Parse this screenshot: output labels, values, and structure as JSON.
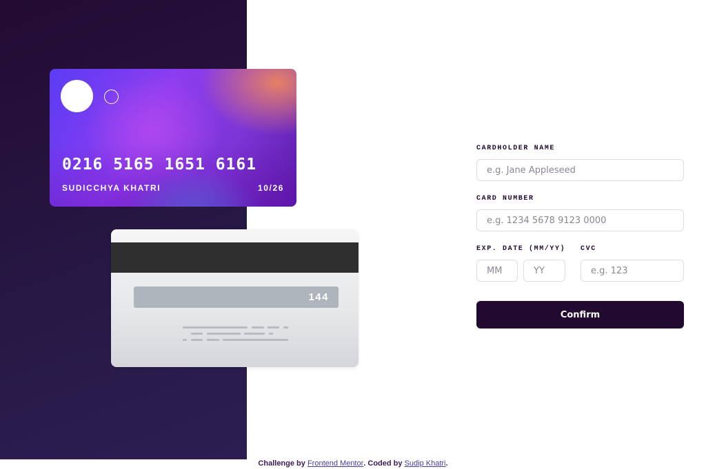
{
  "card_front": {
    "number": "0216 5165 1651 6161",
    "holder": "SUDICCHYA KHATRI",
    "expiry": "10/26"
  },
  "card_back": {
    "cvc": "144"
  },
  "form": {
    "name_label": "CARDHOLDER NAME",
    "name_placeholder": "e.g. Jane Appleseed",
    "number_label": "CARD NUMBER",
    "number_placeholder": "e.g. 1234 5678 9123 0000",
    "exp_label": "EXP. DATE (MM/YY)",
    "mm_placeholder": "MM",
    "yy_placeholder": "YY",
    "cvc_label": "CVC",
    "cvc_placeholder": "e.g. 123",
    "confirm_label": "Confirm"
  },
  "footer": {
    "challenge_prefix": "Challenge by",
    "challenge_link": "Frontend Mentor",
    "coded_prefix": ". Coded by",
    "coded_link": "Sudip Khatri",
    "suffix": "."
  },
  "colors": {
    "dark_violet": "#21092f",
    "border": "#dedddf"
  }
}
